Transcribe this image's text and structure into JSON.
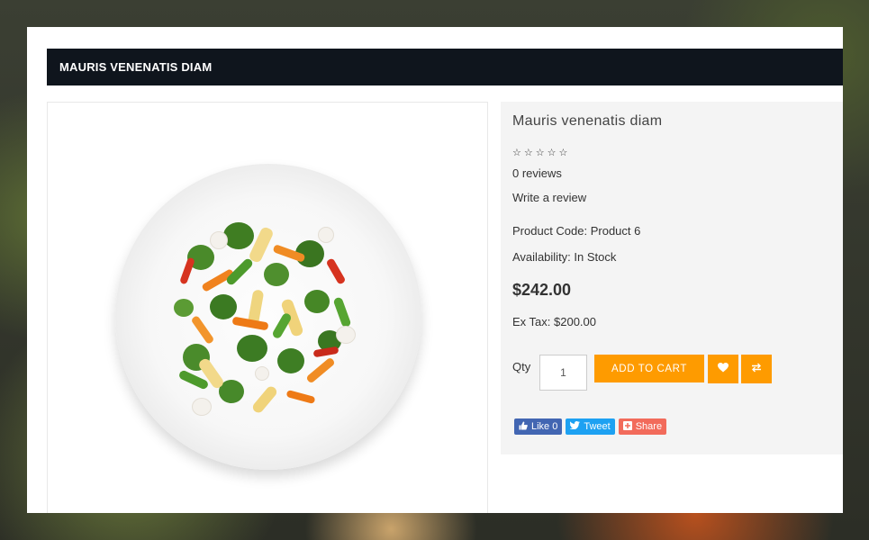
{
  "modal": {
    "title": "MAURIS VENENATIS DIAM"
  },
  "product": {
    "name": "Mauris venenatis diam",
    "rating_stars": "☆☆☆☆☆",
    "reviews": "0 reviews",
    "write_review": "Write a review",
    "product_code": "Product Code: Product 6",
    "availability": "Availability: In Stock",
    "price": "$242.00",
    "ex_tax": "Ex Tax: $200.00",
    "image_alt": "Stir fry vegetables on white plate"
  },
  "cart": {
    "qty_label": "Qty",
    "qty_value": "1",
    "add_to_cart": "ADD TO CART",
    "wishlist_icon": "heart-icon",
    "compare_icon": "exchange-icon"
  },
  "share": {
    "facebook": "Like 0",
    "twitter": "Tweet",
    "share": "Share"
  },
  "colors": {
    "accent": "#fe9b00",
    "title_bar": "#0f151d",
    "info_bg": "#f4f4f4",
    "facebook": "#4266b2",
    "twitter": "#1da1f2",
    "share": "#f26b5b"
  }
}
